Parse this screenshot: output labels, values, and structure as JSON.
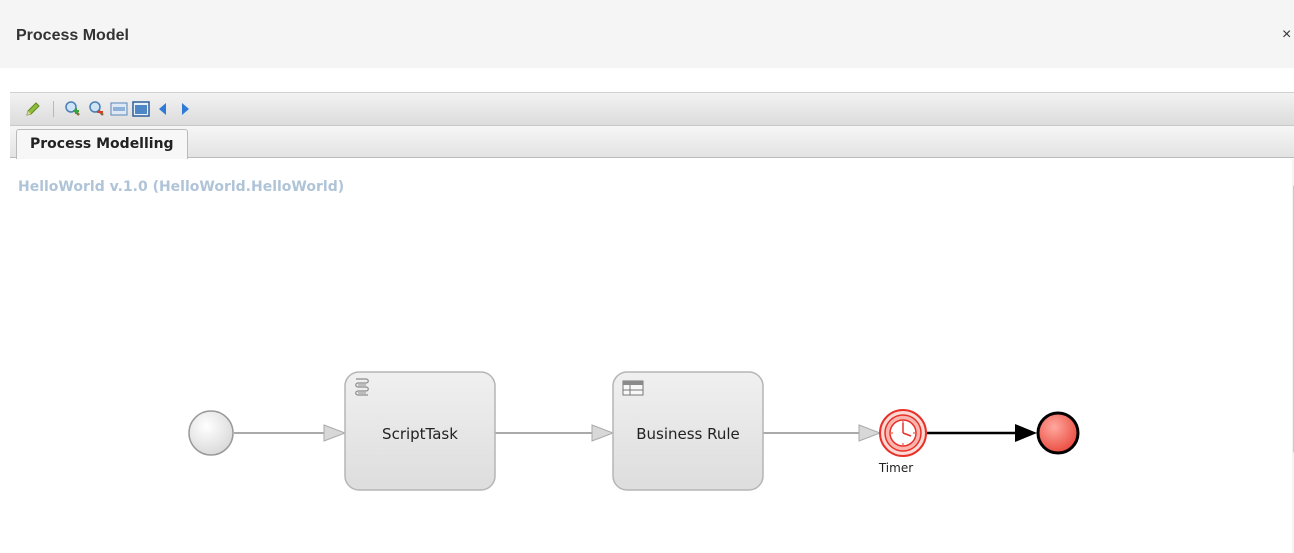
{
  "header": {
    "title": "Process Model",
    "close_label": "×"
  },
  "toolbar": {
    "buttons": [
      {
        "icon": "pencil-icon"
      },
      {
        "icon": "zoom-in-icon"
      },
      {
        "icon": "zoom-out-icon"
      },
      {
        "icon": "actual-size-icon"
      },
      {
        "icon": "fit-to-window-icon"
      },
      {
        "icon": "arrow-left-icon"
      },
      {
        "icon": "arrow-right-icon"
      }
    ]
  },
  "tabs": [
    {
      "label": "Process Modelling"
    }
  ],
  "process": {
    "title": "HelloWorld v.1.0 (HelloWorld.HelloWorld)",
    "nodes": {
      "script_task": "ScriptTask",
      "business_rule": "Business Rule",
      "timer": "Timer"
    }
  },
  "colors": {
    "title_color": "#b0c4d8",
    "task_fill": "#e6e6e6",
    "end_event_fill": "#f05a50",
    "timer_red": "#e8312a",
    "flow_line": "#aaaaaa"
  }
}
